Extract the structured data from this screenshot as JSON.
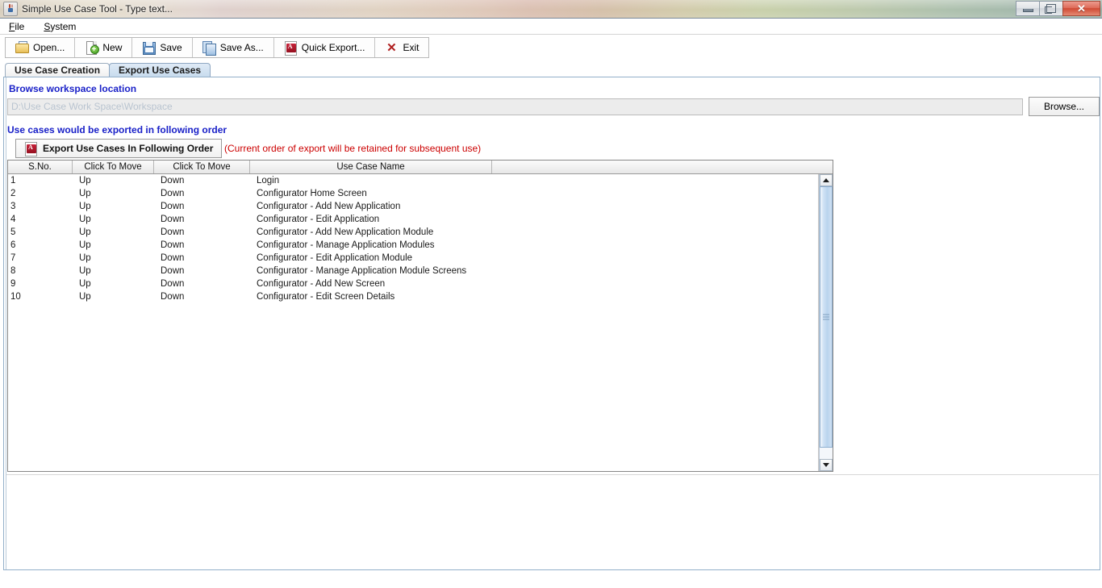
{
  "window": {
    "title": "Simple Use Case Tool - Type text...",
    "app_icon": "java-coffee-cup-icon",
    "minimize_label": "",
    "restore_label": "",
    "close_label": "✕"
  },
  "menubar": {
    "items": [
      {
        "mnemonic": "F",
        "rest": "ile",
        "name": "menu-file"
      },
      {
        "mnemonic": "S",
        "rest": "ystem",
        "name": "menu-system"
      }
    ]
  },
  "toolbar": {
    "buttons": [
      {
        "label": "Open...",
        "icon": "open-folder-icon"
      },
      {
        "label": "New",
        "icon": "new-document-icon"
      },
      {
        "label": "Save",
        "icon": "floppy-disk-icon"
      },
      {
        "label": "Save As...",
        "icon": "save-as-icon"
      },
      {
        "label": "Quick Export...",
        "icon": "pdf-export-icon"
      },
      {
        "label": "Exit",
        "icon": "close-x-icon"
      }
    ]
  },
  "tabs": [
    {
      "label": "Use Case Creation",
      "selected": false
    },
    {
      "label": "Export Use Cases",
      "selected": true
    }
  ],
  "panel": {
    "browse_label": "Browse workspace location",
    "workspace_path": "D:\\Use Case Work Space\\Workspace",
    "browse_button": "Browse...",
    "order_label": "Use cases would be exported in following order",
    "export_button": "Export Use Cases In Following Order",
    "export_button_icon": "pdf-export-icon",
    "export_note": "(Current order of export will be retained for subsequent use)"
  },
  "table": {
    "columns": [
      "S.No.",
      "Click To Move",
      "Click To Move",
      "Use Case Name",
      ""
    ],
    "rows": [
      {
        "sno": "1",
        "up": "Up",
        "down": "Down",
        "name": "Login"
      },
      {
        "sno": "2",
        "up": "Up",
        "down": "Down",
        "name": "Configurator Home Screen"
      },
      {
        "sno": "3",
        "up": "Up",
        "down": "Down",
        "name": "Configurator - Add New Application"
      },
      {
        "sno": "4",
        "up": "Up",
        "down": "Down",
        "name": "Configurator - Edit Application"
      },
      {
        "sno": "5",
        "up": "Up",
        "down": "Down",
        "name": "Configurator - Add New Application Module"
      },
      {
        "sno": "6",
        "up": "Up",
        "down": "Down",
        "name": "Configurator - Manage Application Modules"
      },
      {
        "sno": "7",
        "up": "Up",
        "down": "Down",
        "name": "Configurator - Edit Application Module"
      },
      {
        "sno": "8",
        "up": "Up",
        "down": "Down",
        "name": "Configurator - Manage Application Module Screens"
      },
      {
        "sno": "9",
        "up": "Up",
        "down": "Down",
        "name": "Configurator - Add New Screen"
      },
      {
        "sno": "10",
        "up": "Up",
        "down": "Down",
        "name": "Configurator - Edit Screen Details"
      }
    ]
  },
  "colors": {
    "label_blue": "#1a21c8",
    "note_red": "#cc0000",
    "panel_border": "#93afc9",
    "tab_selected": "#c8dcee",
    "scrollbar_thumb": "#b9d4ee"
  }
}
